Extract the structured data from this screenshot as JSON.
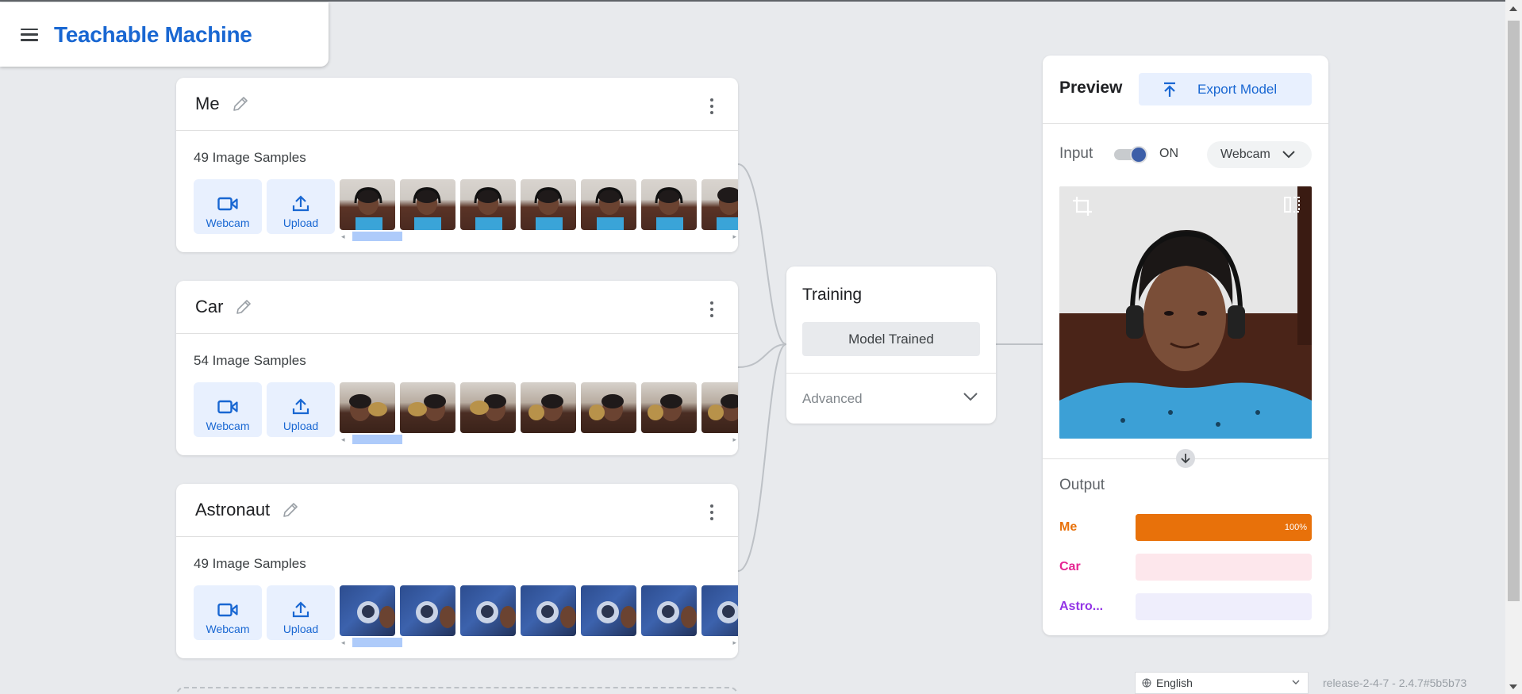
{
  "app": {
    "title": "Teachable Machine"
  },
  "classes": [
    {
      "name": "Me",
      "sample_count": "49 Image Samples",
      "webcam_label": "Webcam",
      "upload_label": "Upload",
      "thumb_style": "face"
    },
    {
      "name": "Car",
      "sample_count": "54 Image Samples",
      "webcam_label": "Webcam",
      "upload_label": "Upload",
      "thumb_style": "car"
    },
    {
      "name": "Astronaut",
      "sample_count": "49 Image Samples",
      "webcam_label": "Webcam",
      "upload_label": "Upload",
      "thumb_style": "astro"
    }
  ],
  "training": {
    "title": "Training",
    "status_button": "Model Trained",
    "advanced_label": "Advanced"
  },
  "preview": {
    "title": "Preview",
    "export_label": "Export Model",
    "input_label": "Input",
    "toggle_state": "ON",
    "source": "Webcam",
    "output_label": "Output",
    "outputs": [
      {
        "name": "Me",
        "confidence": 1.0,
        "percent_label": "100%",
        "color": "#e8710a",
        "track_color": "#e8710a"
      },
      {
        "name": "Car",
        "confidence": 0.0,
        "percent_label": "",
        "color": "#e52592",
        "track_color": "#fde7ec"
      },
      {
        "name": "Astro...",
        "confidence": 0.0,
        "percent_label": "",
        "color": "#9334e6",
        "track_color": "#efeefc"
      }
    ]
  },
  "footer": {
    "language": "English",
    "version": "release-2-4-7 - 2.4.7#5b5b73"
  },
  "colors": {
    "accent": "#1967d2",
    "accent_bg": "#e8f0fe",
    "page_bg": "#e8eaed"
  },
  "icons": [
    "menu-icon",
    "pencil-icon",
    "more-vert-icon",
    "webcam-icon",
    "upload-icon",
    "export-icon",
    "chevron-down-icon",
    "crop-icon",
    "flip-icon",
    "arrow-down-icon",
    "globe-icon"
  ]
}
